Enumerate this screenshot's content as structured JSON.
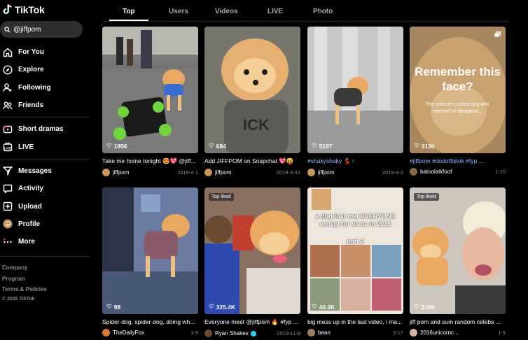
{
  "app": {
    "name": "TikTok"
  },
  "search": {
    "value": "@jiffpom"
  },
  "nav": [
    {
      "label": "For You",
      "icon": "home-icon"
    },
    {
      "label": "Explore",
      "icon": "compass-icon"
    },
    {
      "label": "Following",
      "icon": "user-plus-icon"
    },
    {
      "label": "Friends",
      "icon": "friends-icon"
    },
    {
      "label": "Short dramas",
      "icon": "short-dramas-icon"
    },
    {
      "label": "LIVE",
      "icon": "live-icon"
    },
    {
      "label": "Messages",
      "icon": "send-icon"
    },
    {
      "label": "Activity",
      "icon": "activity-icon"
    },
    {
      "label": "Upload",
      "icon": "upload-icon"
    },
    {
      "label": "Profile",
      "icon": "avatar-icon"
    },
    {
      "label": "More",
      "icon": "more-icon"
    }
  ],
  "footer": {
    "company": "Company",
    "program": "Program",
    "terms": "Terms & Policies",
    "copyright": "© 2026 TikTok"
  },
  "tabs": [
    "Top",
    "Users",
    "Videos",
    "LIVE",
    "Photo"
  ],
  "videos": [
    {
      "likes": "1956",
      "caption": "Take me home tonight 😍💖 @jiffp...",
      "author": "jiffpom",
      "date": "2019-4-1",
      "badge": ""
    },
    {
      "likes": "684",
      "caption": "Add JIFFPOM on Snapchat 💖😝",
      "author": "jiffpom",
      "date": "2019-3-31",
      "badge": ""
    },
    {
      "likes": "5197",
      "caption": "#shakyshaky 💃♀",
      "author": "jiffpom",
      "date": "2019-4-2",
      "badge": ""
    },
    {
      "likes": "3136",
      "caption": "#jiffpom #dodoftiktok #fyp ...",
      "author": "batoolalkfoof",
      "date": "1-10",
      "badge": "",
      "overlay_title": "Remember this face?",
      "overlay_sub": "The internet's cutest dog who seemed to disappear..."
    },
    {
      "likes": "98",
      "caption": "Spider-dog, spider-dog, doing wh...",
      "author": "TheDailyFox",
      "date": "1-9",
      "badge": ""
    },
    {
      "likes": "325.4K",
      "caption": "Everyone meet @jiffpom 🔥 #fyp ...",
      "author": "Ryan Shakes",
      "date": "2019-11-9",
      "badge": "Top liked",
      "verified": true
    },
    {
      "likes": "40.2K",
      "caption": "big mess up in the last video, i ma...",
      "author": "bean",
      "date": "3-17",
      "badge": "",
      "overlay_title": "a dog that met EVERYONE except for siena in 2016",
      "overlay_sub": "part 2"
    },
    {
      "likes": "3.5M",
      "caption": "jiff pom and sum random celebs ...",
      "author": "2016unicornc...",
      "date": "1-9",
      "badge": "Top liked"
    }
  ],
  "colors": {
    "accent": "#fe2c55",
    "link": "#8fb9ff",
    "bg": "#000000"
  }
}
